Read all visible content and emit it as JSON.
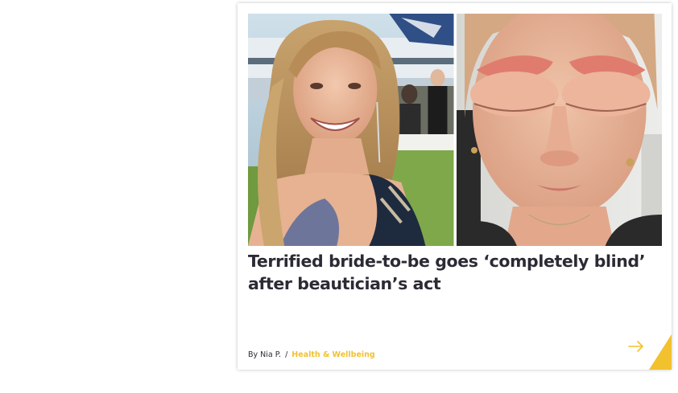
{
  "article": {
    "title": "Terrified bride-to-be goes ‘completely blind’ after beautician’s act",
    "byline_prefix": "By",
    "author": "Nia P.",
    "separator": "/",
    "category": "Health & Wellbeing",
    "images": [
      {
        "icon": "photo-smiling-woman"
      },
      {
        "icon": "photo-swollen-face"
      }
    ]
  },
  "colors": {
    "accent": "#f2c12e",
    "title_text": "#2b2b35"
  },
  "icons": {
    "read_more": "arrow-right-icon",
    "corner": "corner-triangle-icon"
  }
}
